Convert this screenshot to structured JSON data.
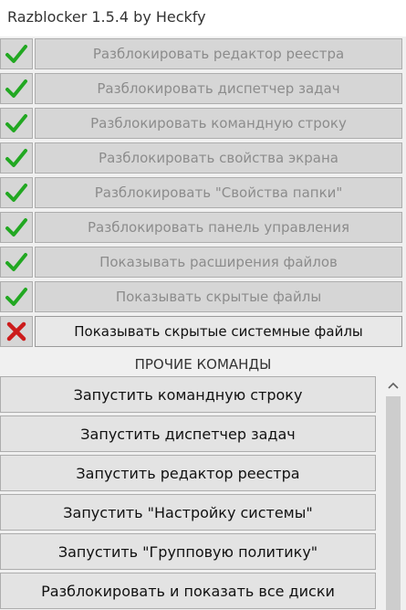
{
  "window": {
    "title": "Razblocker 1.5.4 by Heckfy"
  },
  "options": [
    {
      "label": "Разблокировать редактор реестра",
      "status": "enabled",
      "icon": "check-icon"
    },
    {
      "label": "Разблокировать диспетчер задач",
      "status": "enabled",
      "icon": "check-icon"
    },
    {
      "label": "Разблокировать командную строку",
      "status": "enabled",
      "icon": "check-icon"
    },
    {
      "label": "Разблокировать свойства экрана",
      "status": "enabled",
      "icon": "check-icon"
    },
    {
      "label": "Разблокировать \"Свойства папки\"",
      "status": "enabled",
      "icon": "check-icon"
    },
    {
      "label": "Разблокировать панель управления",
      "status": "enabled",
      "icon": "check-icon"
    },
    {
      "label": "Показывать расширения файлов",
      "status": "enabled",
      "icon": "check-icon"
    },
    {
      "label": "Показывать скрытые файлы",
      "status": "enabled",
      "icon": "check-icon"
    },
    {
      "label": "Показывать скрытые системные файлы",
      "status": "disabled",
      "icon": "cross-icon"
    }
  ],
  "other_commands": {
    "heading": "ПРОЧИЕ КОМАНДЫ",
    "items": [
      "Запустить командную строку",
      "Запустить диспетчер задач",
      "Запустить редактор реестра",
      "Запустить \"Настройку системы\"",
      "Запустить \"Групповую политику\"",
      "Разблокировать и показать все диски"
    ]
  },
  "colors": {
    "check": "#22a822",
    "cross": "#cc1b1b"
  }
}
